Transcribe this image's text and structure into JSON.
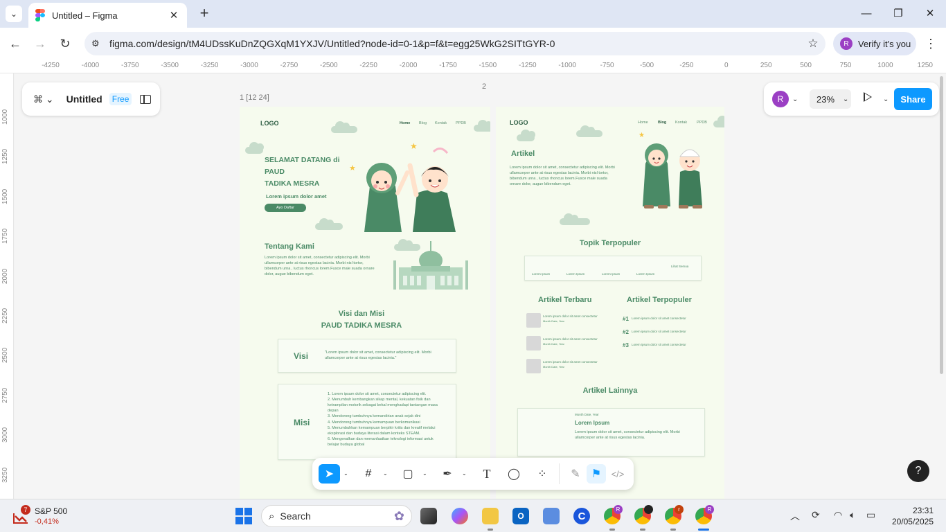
{
  "browser": {
    "tab_title": "Untitled – Figma",
    "url": "figma.com/design/tM4UDssKuDnZQGXqM1YXJV/Untitled?node-id=0-1&p=f&t=egg25WkG2SITtGYR-0",
    "verify_label": "Verify it's you",
    "profile_initial": "R"
  },
  "figma": {
    "file_name": "Untitled",
    "plan_badge": "Free",
    "zoom": "23%",
    "share_label": "Share",
    "user_initial": "R",
    "ruler_x": [
      "-4250",
      "-4000",
      "-3750",
      "-3500",
      "-3250",
      "-3000",
      "-2750",
      "-2500",
      "-2250",
      "-2000",
      "-1750",
      "-1500",
      "-1250",
      "-1000",
      "-750",
      "-500",
      "-250",
      "0",
      "250",
      "500",
      "750",
      "1000",
      "1250"
    ],
    "ruler_y": [
      "1000",
      "1250",
      "1500",
      "1750",
      "2000",
      "2250",
      "2500",
      "2750",
      "3000",
      "3250"
    ],
    "frame_labels": {
      "frame1": "1 [12 24]",
      "frame2": "2"
    }
  },
  "frame1": {
    "logo": "LOGO",
    "nav": [
      "Home",
      "Blog",
      "Kontak",
      "PPDB"
    ],
    "hero_line1": "SELAMAT DATANG di",
    "hero_line2": "PAUD",
    "hero_line3": "TADIKA MESRA",
    "hero_sub": "Lorem ipsum dolor amet",
    "hero_button": "Ayo Daftar",
    "about_title": "Tentang Kami",
    "about_text": "Lorem ipsum dolor sit amet, consectetur adipiscing elit. Morbi ullamcorper ante at risus egestas lacinia. Morbi nisl tortor, bibendum urna , luctus rhoncus lorem.Fusce male suada ornare dolor, augue bibendum eget.",
    "vision_title_1": "Visi dan Misi",
    "vision_title_2": "PAUD TADIKA MESRA",
    "visi_label": "Visi",
    "visi_text": "\"Lorem ipsum dolor sit amet, consectetur adipiscing elit. Morbi ullamcorper ante at risus egestas lacinia.\"",
    "misi_label": "Misi",
    "misi_items": [
      "1. Lorem ipsum dolor sit amet, consectetur adipiscing elit.",
      "2. Menumbuh kembangkan sikap mental, kekuatan fisik dan ketrampilan motorik sebagai bekal menghadapi tantangan masa depan",
      "3. Mendorong tumbuhnya kemandirian anak sejak dini",
      "4. Mendorong tumbuhnya kemampuan berkomunikasi",
      "5. Menumbuhkan kemampuan berpikir kritis dan kreatif melalui eksplorasi dan budaya literasi dalam konteks STEAM.",
      "6. Mengenalkan dan memanfaatkan teknologi informasi untuk belajar budaya global"
    ]
  },
  "frame2": {
    "logo": "LOGO",
    "nav": [
      "Home",
      "Blog",
      "Kontak",
      "PPDB"
    ],
    "artikel_title": "Artikel",
    "artikel_text": "Lorem ipsum dolor sit amet, consectetur adipiscing elit. Morbi ullamcorper ante at risus egestas lacinia. Morbi nisl tortor, bibendum urna , luctus rhoncus lorem.Fusce male suada ornare dolor, augue bibendum eget.",
    "topik_title": "Topik Terpopuler",
    "topik_right": "Lihat Semua",
    "topik_items": [
      "Lorem Ipsum",
      "Lorem Ipsum",
      "Lorem Ipsum",
      "Lorem Ipsum"
    ],
    "terbaru_title": "Artikel Terbaru",
    "terpopuler_title": "Artikel Terpopuler",
    "terbaru_items": [
      {
        "title": "Lorem ipsum dolor sit amet consectetur",
        "date": "Month Date, Year"
      },
      {
        "title": "Lorem ipsum dolor sit amet consectetur",
        "date": "Month Date, Year"
      },
      {
        "title": "Lorem ipsum dolor sit amet consectetur",
        "date": "Month Date, Year"
      }
    ],
    "terpopuler_items": [
      {
        "rank": "#1",
        "title": "Lorem ipsum dolor sit amet consectetur"
      },
      {
        "rank": "#2",
        "title": "Lorem ipsum dolor sit amet consectetur"
      },
      {
        "rank": "#3",
        "title": "Lorem ipsum dolor sit amet consectetur"
      }
    ],
    "lainnya_title": "Artikel Lainnya",
    "lainnya_date": "Month Date, Year",
    "lainnya_card_title": "Lorem Ipsum",
    "lainnya_card_text": "Lorem ipsum dolor sit amet, consectetur adipiscing elit. Morbi ullamcorper ante at risus egestas lacinia."
  },
  "taskbar": {
    "stock_name": "S&P 500",
    "stock_change": "-0,41%",
    "stock_badge": "7",
    "search_label": "Search",
    "time": "23:31",
    "date": "20/05/2025"
  },
  "colors": {
    "figma_blue": "#0d99ff",
    "brand_green": "#4a8a66",
    "frame_bg": "#f6fbee"
  }
}
